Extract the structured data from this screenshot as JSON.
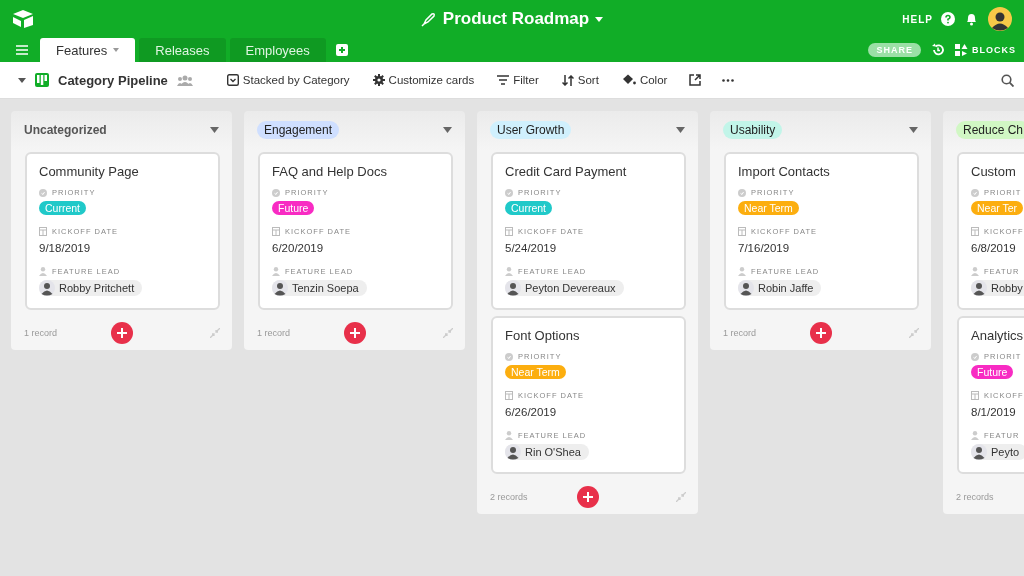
{
  "app": {
    "title": "Product Roadmap",
    "help": "HELP",
    "share": "SHARE",
    "blocks": "BLOCKS"
  },
  "tabs": [
    {
      "label": "Features",
      "selected": true
    },
    {
      "label": "Releases",
      "selected": false
    },
    {
      "label": "Employees",
      "selected": false
    }
  ],
  "view": {
    "name": "Category Pipeline",
    "tools": [
      {
        "kind": "stack",
        "label": "Stacked by Category"
      },
      {
        "kind": "customize",
        "label": "Customize cards"
      },
      {
        "kind": "filter",
        "label": "Filter"
      },
      {
        "kind": "sort",
        "label": "Sort"
      },
      {
        "kind": "color",
        "label": "Color"
      }
    ]
  },
  "columns": [
    {
      "kind": "plain",
      "label": "Uncategorized",
      "footer": "1 record",
      "cards": [
        {
          "title": "Community Page",
          "fields": [
            "PRIORITY",
            "KICKOFF DATE",
            "FEATURE LEAD"
          ],
          "priority": {
            "label": "Current",
            "color": "#20c9c9"
          },
          "date": "9/18/2019",
          "lead": "Robby Pritchett"
        }
      ]
    },
    {
      "kind": "tag",
      "label": "Engagement",
      "color": "#cfdfff",
      "footer": "1 record",
      "cards": [
        {
          "title": "FAQ and Help Docs",
          "fields": [
            "PRIORITY",
            "KICKOFF DATE",
            "FEATURE LEAD"
          ],
          "priority": {
            "label": "Future",
            "color": "#f82bc3"
          },
          "date": "6/20/2019",
          "lead": "Tenzin Soepa"
        }
      ]
    },
    {
      "kind": "tag",
      "label": "User Growth",
      "color": "#d0f0fd",
      "footer": "2 records",
      "cards": [
        {
          "title": "Credit Card Payment",
          "fields": [
            "PRIORITY",
            "KICKOFF DATE",
            "FEATURE LEAD"
          ],
          "priority": {
            "label": "Current",
            "color": "#20c9c9"
          },
          "date": "5/24/2019",
          "lead": "Peyton Devereaux"
        },
        {
          "title": "Font Options",
          "fields": [
            "PRIORITY",
            "KICKOFF DATE",
            "FEATURE LEAD"
          ],
          "priority": {
            "label": "Near Term",
            "color": "#fcae0f"
          },
          "date": "6/26/2019",
          "lead": "Rin O'Shea"
        }
      ]
    },
    {
      "kind": "tag",
      "label": "Usability",
      "color": "#c2f5e9",
      "footer": "1 record",
      "cards": [
        {
          "title": "Import Contacts",
          "fields": [
            "PRIORITY",
            "KICKOFF DATE",
            "FEATURE LEAD"
          ],
          "priority": {
            "label": "Near Term",
            "color": "#fcae0f"
          },
          "date": "7/16/2019",
          "lead": "Robin Jaffe"
        }
      ]
    },
    {
      "kind": "tag",
      "label": "Reduce Ch",
      "color": "#d1f7c4",
      "footer": "2 records",
      "cards": [
        {
          "title": "Custom",
          "fields": [
            "PRIORIT",
            "KICKOFF",
            "FEATUR"
          ],
          "priority": {
            "label": "Near Ter",
            "color": "#fcae0f"
          },
          "date": "6/8/2019",
          "lead": "Robby"
        },
        {
          "title": "Analytics",
          "fields": [
            "PRIORIT",
            "KICKOFF",
            "FEATUR"
          ],
          "priority": {
            "label": "Future",
            "color": "#f82bc3"
          },
          "date": "8/1/2019",
          "lead": "Peyto"
        }
      ]
    }
  ]
}
